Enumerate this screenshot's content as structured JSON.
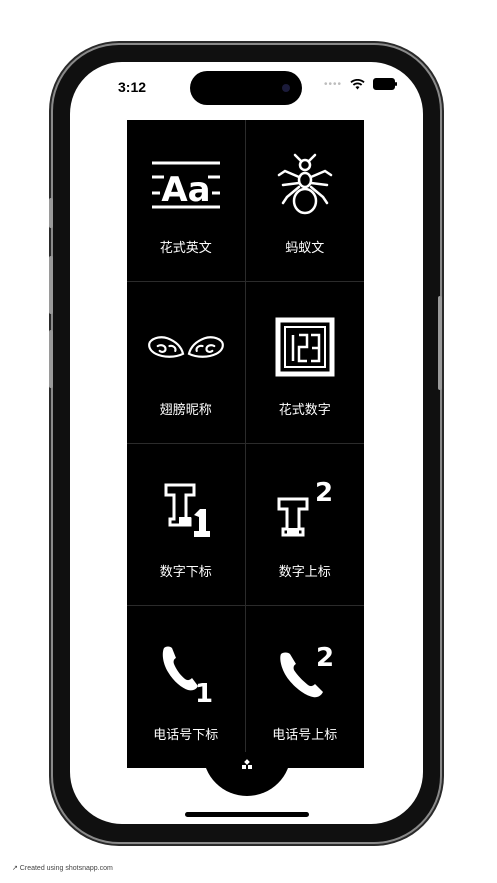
{
  "status_bar": {
    "time": "3:12"
  },
  "grid": {
    "items": [
      {
        "label": "花式英文",
        "icon": "fancy-letters-icon"
      },
      {
        "label": "蚂蚁文",
        "icon": "ant-icon"
      },
      {
        "label": "翅膀昵称",
        "icon": "wings-icon"
      },
      {
        "label": "花式数字",
        "icon": "boxed-123-icon"
      },
      {
        "label": "数字下标",
        "icon": "subscript-t1-icon"
      },
      {
        "label": "数字上标",
        "icon": "superscript-t2-icon"
      },
      {
        "label": "电话号下标",
        "icon": "phone-subscript-1-icon"
      },
      {
        "label": "电话号上标",
        "icon": "phone-superscript-2-icon"
      }
    ]
  },
  "footer": {
    "credit": "↗ Created using shotsnapp.com"
  }
}
